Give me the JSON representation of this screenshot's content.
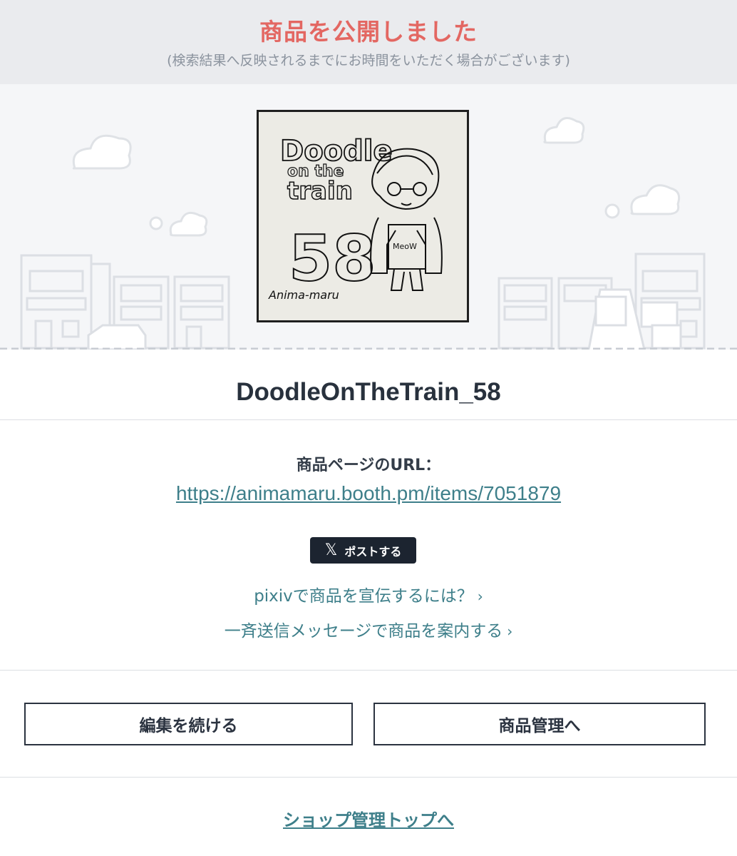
{
  "banner": {
    "title": "商品を公開しました",
    "subtitle": "(検索結果へ反映されるまでにお時間をいただく場合がございます)"
  },
  "product": {
    "title": "DoodleOnTheTrain_58",
    "thumbnail": {
      "heading_line1": "Doodle",
      "heading_line2": "on the",
      "heading_line3": "train",
      "number": "58",
      "signature": "Anima-maru",
      "shirt_text": "MeoW"
    }
  },
  "url_section": {
    "label": "商品ページのURL：",
    "url": "https://animamaru.booth.pm/items/7051879"
  },
  "share": {
    "post_label": "ポストする",
    "x_icon": "𝕏"
  },
  "promo": {
    "pixiv_link": "pixivで商品を宣伝するには？",
    "message_link": "一斉送信メッセージで商品を案内する",
    "chevron": "›"
  },
  "actions": {
    "continue_edit": "編集を続ける",
    "manage_items": "商品管理へ"
  },
  "footer": {
    "shop_top_link": "ショップ管理トップへ"
  },
  "colors": {
    "accent_red": "#e36762",
    "link_teal": "#3e7f8a",
    "dark_navy": "#1c2430"
  }
}
